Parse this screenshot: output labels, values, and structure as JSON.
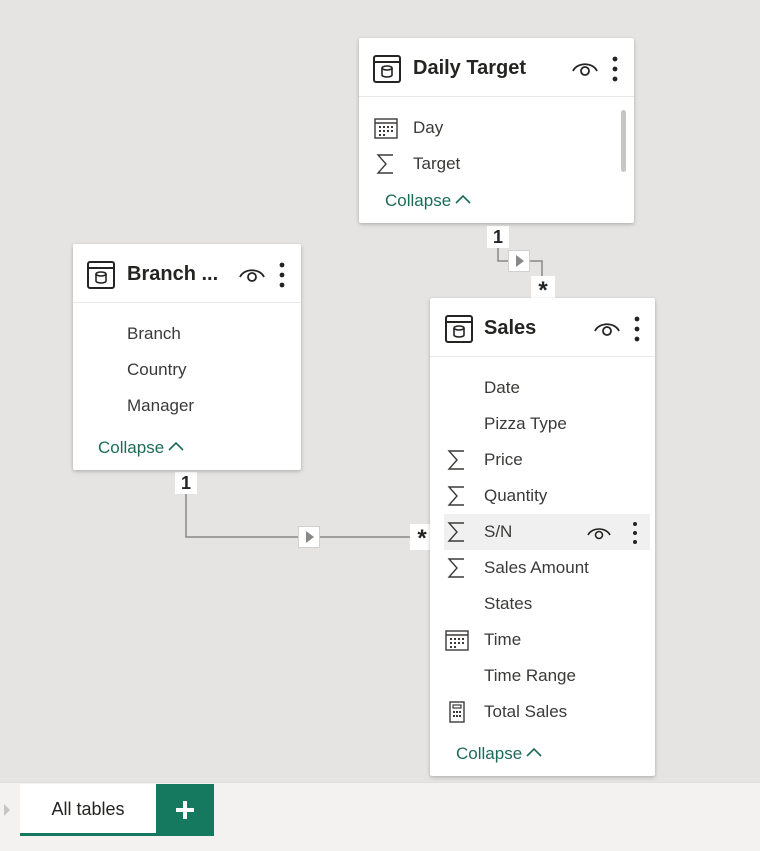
{
  "cards": {
    "daily_target": {
      "title": "Daily Target",
      "fields": [
        {
          "name": "Day",
          "icon": "calendar-icon"
        },
        {
          "name": "Target",
          "icon": "sigma-icon"
        }
      ],
      "collapse": "Collapse"
    },
    "branch": {
      "title": "Branch ...",
      "fields": [
        {
          "name": "Branch",
          "icon": ""
        },
        {
          "name": "Country",
          "icon": ""
        },
        {
          "name": "Manager",
          "icon": ""
        }
      ],
      "collapse": "Collapse"
    },
    "sales": {
      "title": "Sales",
      "fields": [
        {
          "name": "Date",
          "icon": ""
        },
        {
          "name": "Pizza Type",
          "icon": ""
        },
        {
          "name": "Price",
          "icon": "sigma-icon"
        },
        {
          "name": "Quantity",
          "icon": "sigma-icon"
        },
        {
          "name": "S/N",
          "icon": "sigma-icon"
        },
        {
          "name": "Sales Amount",
          "icon": "sigma-icon"
        },
        {
          "name": "States",
          "icon": ""
        },
        {
          "name": "Time",
          "icon": "calendar-icon"
        },
        {
          "name": "Time Range",
          "icon": ""
        },
        {
          "name": "Total Sales",
          "icon": "calculator-icon"
        }
      ],
      "collapse": "Collapse"
    }
  },
  "relationships": {
    "daily_to_sales": {
      "one": "1",
      "many": "*"
    },
    "branch_to_sales": {
      "one": "1",
      "many": "*"
    }
  },
  "tabs": {
    "all_tables": "All tables",
    "add_label": "+"
  },
  "colors": {
    "accent": "#15795f",
    "collapse_text": "#1c6b59",
    "canvas": "#e6e4e2"
  }
}
